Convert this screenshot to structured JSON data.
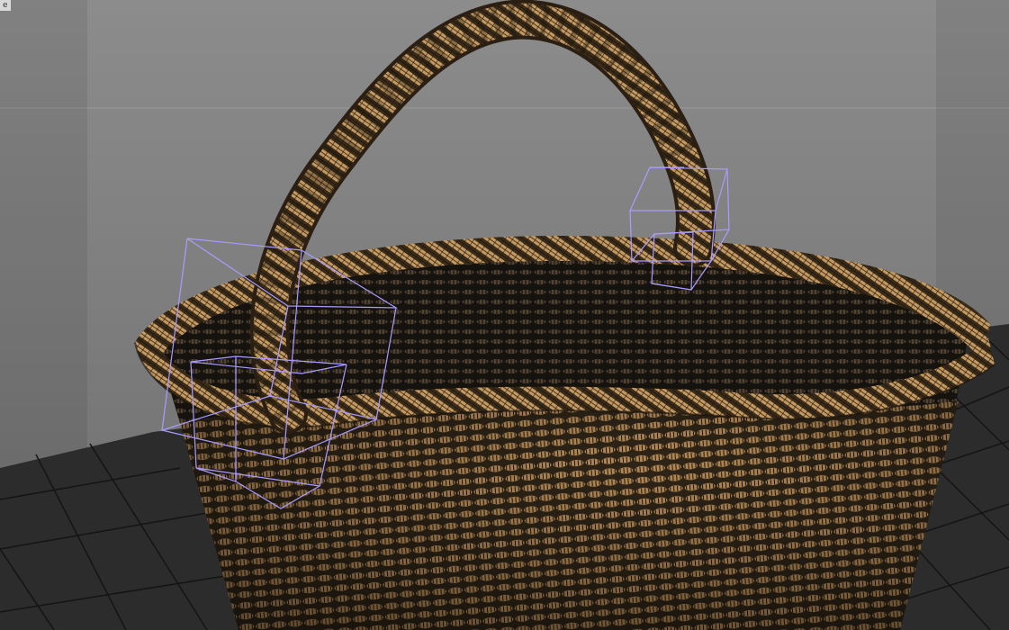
{
  "viewport": {
    "corner_label": "e",
    "object": "wicker-basket",
    "shading": "wireframe-on-shaded",
    "selection": "handle-bounding-boxes",
    "colors": {
      "background_top": "#8a8a8a",
      "background_bottom": "#6a6a6a",
      "floor": "#2c2c2c",
      "grid_lines": "#141414",
      "wicker_light": "#c9a06a",
      "wicker_dark": "#3a2c1c",
      "selection_box": "#a89cff"
    }
  }
}
